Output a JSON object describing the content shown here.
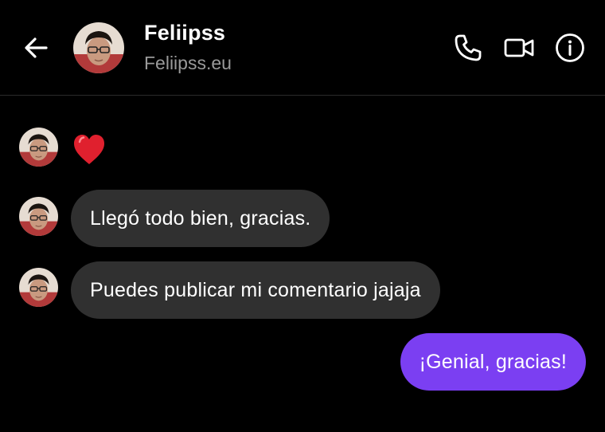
{
  "header": {
    "contact_name": "Feliipss",
    "contact_subtitle": "Feliipss.eu",
    "back_icon": "arrow-left-icon",
    "phone_icon": "phone-icon",
    "video_icon": "video-camera-icon",
    "info_icon": "info-icon"
  },
  "messages": [
    {
      "direction": "incoming",
      "type": "emoji",
      "content": "heart-emoji"
    },
    {
      "direction": "incoming",
      "type": "text",
      "text": "Llegó todo bien, gracias."
    },
    {
      "direction": "incoming",
      "type": "text",
      "text": "Puedes publicar mi comentario jajaja"
    },
    {
      "direction": "outgoing",
      "type": "text",
      "text": "¡Genial, gracias!"
    }
  ],
  "colors": {
    "background": "#000000",
    "incoming_bubble": "#303030",
    "outgoing_bubble": "#7b3ff2",
    "subtitle_text": "#9a9a9a",
    "heart": "#e0202e"
  }
}
